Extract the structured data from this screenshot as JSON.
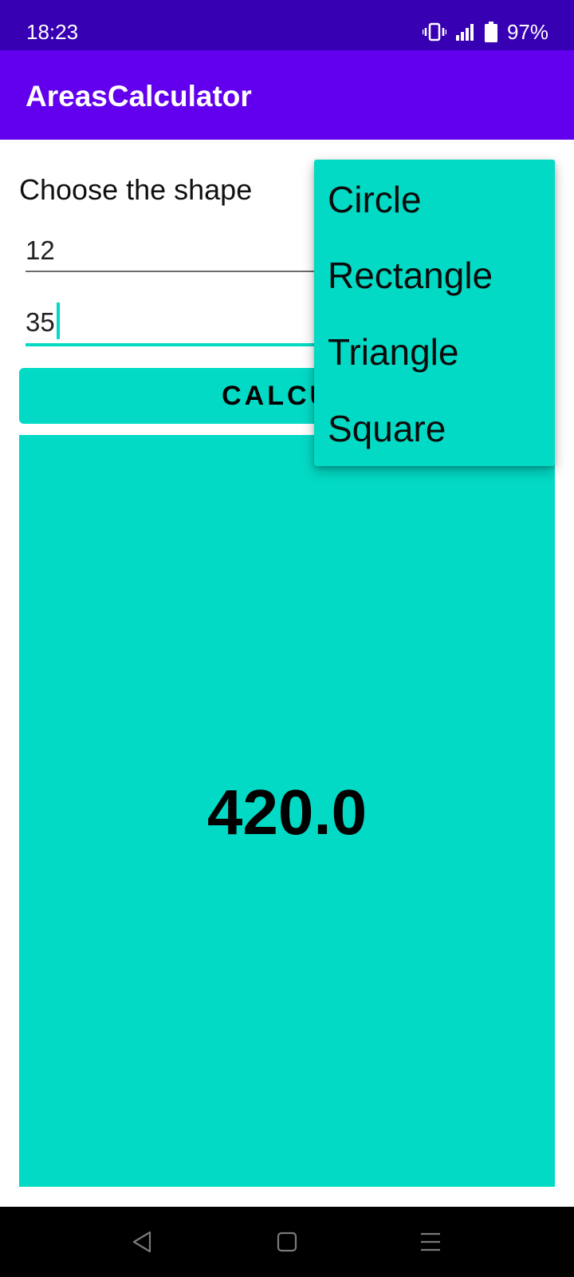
{
  "status_bar": {
    "time": "18:23",
    "battery_percent": "97%",
    "icons": [
      "vibrate-icon",
      "signal-icon",
      "battery-icon"
    ]
  },
  "app_bar": {
    "title": "AreasCalculator"
  },
  "form": {
    "choose_label": "Choose the shape",
    "input_1": {
      "value": "12"
    },
    "input_2": {
      "value": "35"
    },
    "calculate_button_visible_label": "CALCUL"
  },
  "result": {
    "value": "420.0"
  },
  "shape_dropdown": {
    "items": [
      {
        "label": "Circle"
      },
      {
        "label": "Rectangle"
      },
      {
        "label": "Triangle"
      },
      {
        "label": "Square"
      }
    ]
  },
  "nav_bar": {
    "icons": [
      "back-icon",
      "home-icon",
      "menu-icon"
    ]
  },
  "colors": {
    "status_bar": "#3700B3",
    "app_bar": "#6200EE",
    "accent": "#03DAC5",
    "nav_bar": "#000000"
  }
}
